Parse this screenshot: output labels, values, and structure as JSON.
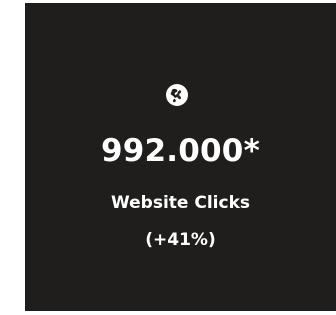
{
  "card": {
    "icon": "globe-americas-icon",
    "value": "992.000*",
    "label": "Website Clicks",
    "change": "(+41%)",
    "colors": {
      "background": "#1f1e1c",
      "text": "#ffffff"
    }
  }
}
